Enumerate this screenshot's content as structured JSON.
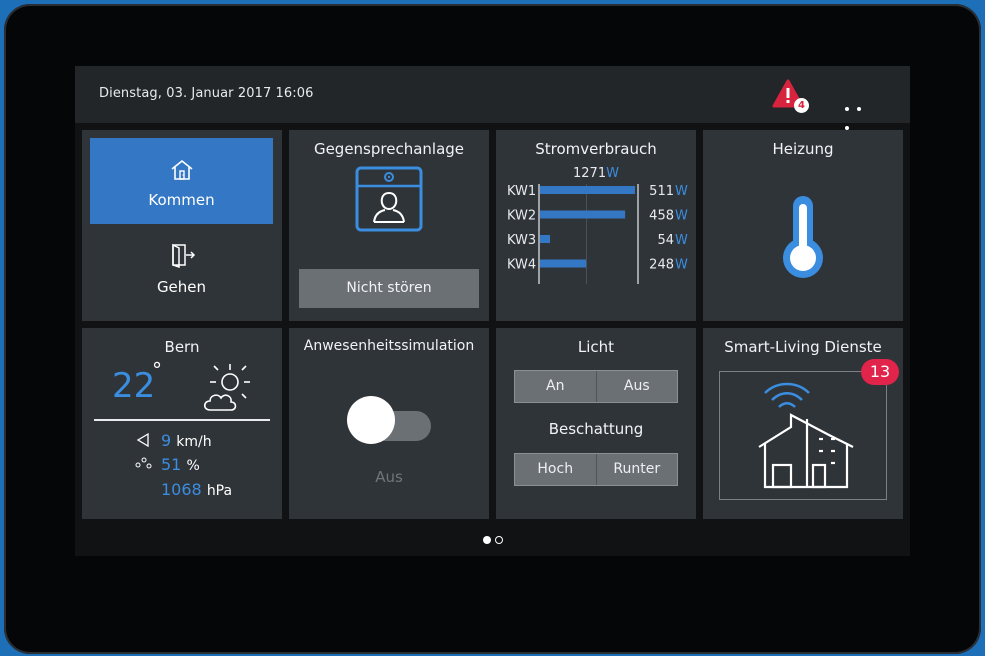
{
  "topbar": {
    "datetime": "Dienstag, 03. Januar 2017 16:06",
    "alert_icon": "warning-icon",
    "alert_count": "4",
    "alert_color": "#d8233f",
    "more_icon": "more-dots-icon"
  },
  "tiles": {
    "presence": {
      "kommen_label": "Kommen",
      "gehen_label": "Gehen",
      "kommen_icon": "house-icon",
      "gehen_icon": "door-exit-icon"
    },
    "intercom": {
      "title": "Gegensprechanlage",
      "icon": "intercom-person-icon",
      "button_label": "Nicht stören"
    },
    "power": {
      "title": "Stromverbrauch",
      "total_value": "1271",
      "total_unit": "W"
    },
    "heating": {
      "title": "Heizung",
      "icon": "thermometer-icon"
    },
    "weather": {
      "city": "Bern",
      "temperature": "22",
      "temperature_unit": "°",
      "condition_icon": "sun-cloud-icon",
      "wind_icon": "wind-direction-icon",
      "wind_value": "9",
      "wind_unit": "km/h",
      "humidity_icon": "droplets-icon",
      "humidity_value": "51",
      "humidity_unit": "%",
      "pressure_value": "1068",
      "pressure_unit": "hPa"
    },
    "simulation": {
      "title": "Anwesenheitssimulation",
      "toggle_state": "Aus"
    },
    "light": {
      "title": "Licht",
      "on_label": "An",
      "off_label": "Aus",
      "shading_title": "Beschattung",
      "up_label": "Hoch",
      "down_label": "Runter"
    },
    "services": {
      "title": "Smart-Living Dienste",
      "badge": "13",
      "icon": "smart-house-wifi-icon"
    }
  },
  "pager": {
    "pages": 2,
    "active": 1
  },
  "colors": {
    "accent": "#3478c5",
    "tile": "#2f3438",
    "badge": "#e0244a"
  },
  "chart_data": {
    "type": "bar",
    "orientation": "horizontal",
    "categories": [
      "KW1",
      "KW2",
      "KW3",
      "KW4"
    ],
    "values": [
      511,
      458,
      54,
      248
    ],
    "value_labels": [
      "511",
      "458",
      "54",
      "248"
    ],
    "unit": "W",
    "total": 1271,
    "xlim": [
      0,
      511
    ]
  }
}
